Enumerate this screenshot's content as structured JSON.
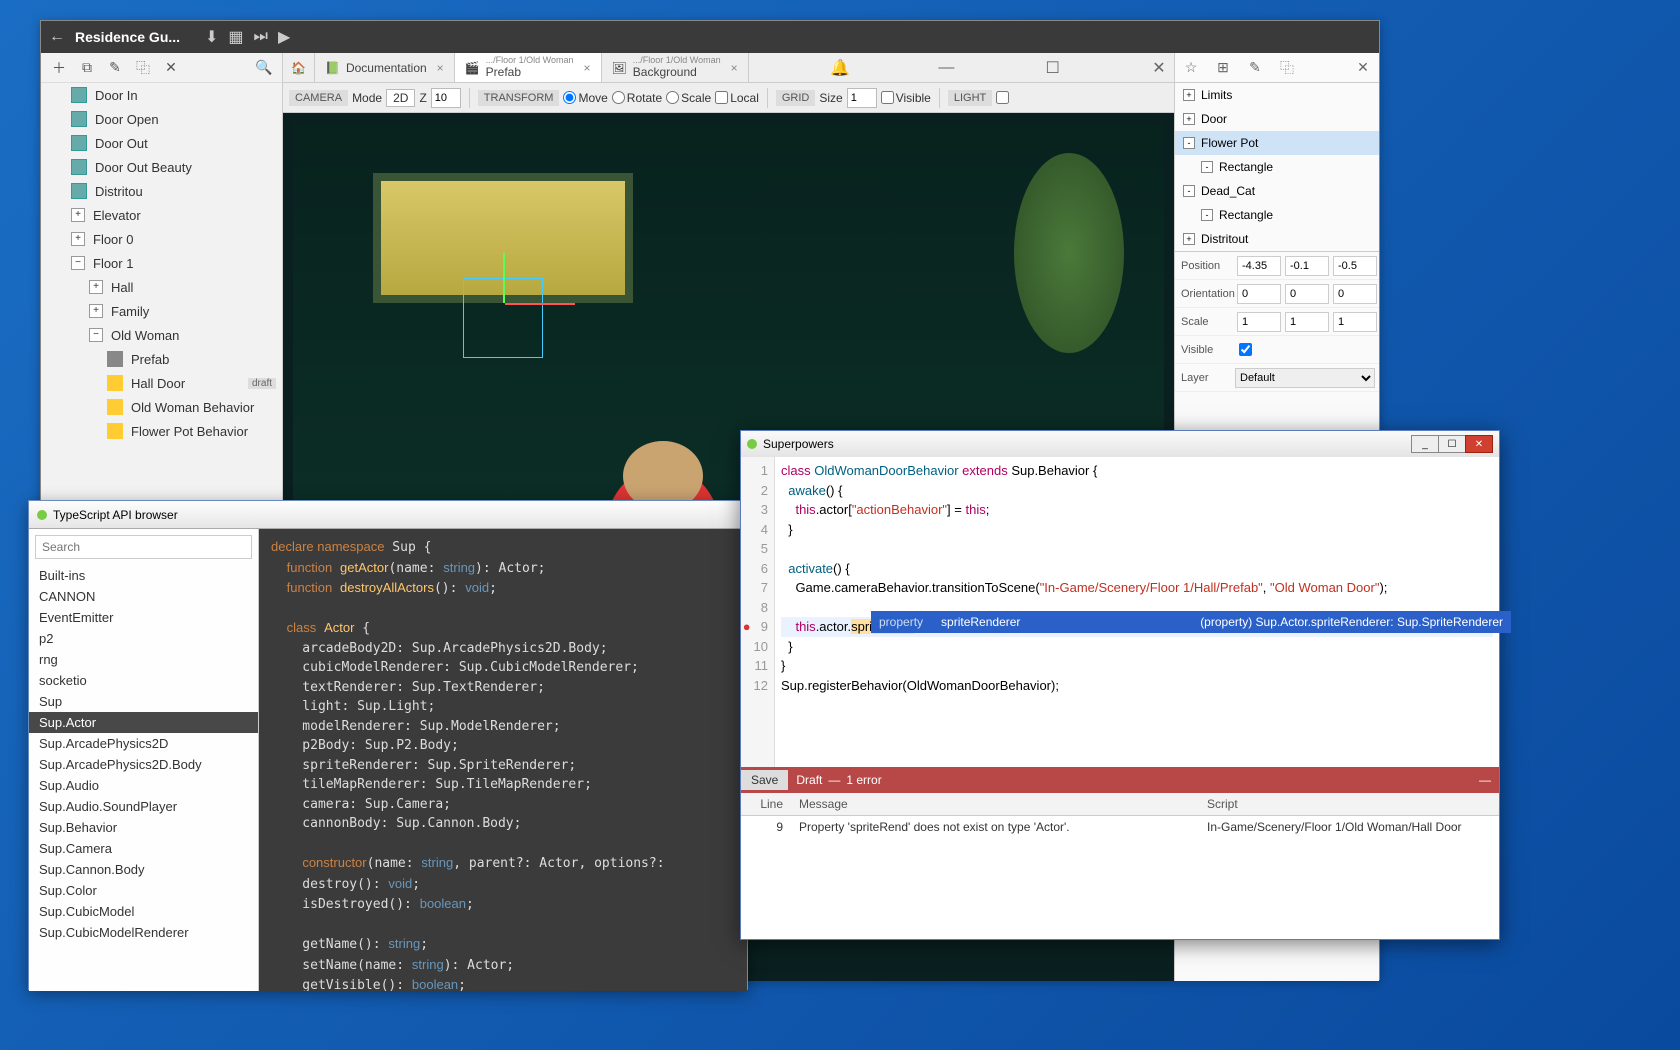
{
  "main": {
    "title": "Residence Gu...",
    "tabs": {
      "doc": "Documentation",
      "prefab_path": ".../Floor 1/Old Woman",
      "prefab_label": "Prefab",
      "bg_path": ".../Floor 1/Old Woman",
      "bg_label": "Background"
    },
    "toolbar": {
      "camera": "CAMERA",
      "mode": "Mode",
      "twoD": "2D",
      "z": "Z",
      "z_val": "10",
      "transform": "TRANSFORM",
      "move": "Move",
      "rotate": "Rotate",
      "scale": "Scale",
      "local": "Local",
      "grid": "GRID",
      "size": "Size",
      "size_val": "1",
      "visible": "Visible",
      "light": "LIGHT"
    },
    "tree": [
      {
        "indent": 1,
        "icon": "img",
        "label": "Door In"
      },
      {
        "indent": 1,
        "icon": "img",
        "label": "Door Open"
      },
      {
        "indent": 1,
        "icon": "img",
        "label": "Door Out"
      },
      {
        "indent": 1,
        "icon": "img",
        "label": "Door Out Beauty"
      },
      {
        "indent": 1,
        "icon": "img",
        "label": "Distritou"
      },
      {
        "indent": 1,
        "icon": "plus",
        "label": "Elevator"
      },
      {
        "indent": 1,
        "icon": "plus",
        "label": "Floor 0"
      },
      {
        "indent": 1,
        "icon": "minus",
        "label": "Floor 1"
      },
      {
        "indent": 2,
        "icon": "plus",
        "label": "Hall"
      },
      {
        "indent": 2,
        "icon": "plus",
        "label": "Family"
      },
      {
        "indent": 2,
        "icon": "minus",
        "label": "Old Woman"
      },
      {
        "indent": 3,
        "icon": "clap",
        "label": "Prefab"
      },
      {
        "indent": 3,
        "icon": "bolt",
        "label": "Hall Door",
        "badge": "draft"
      },
      {
        "indent": 3,
        "icon": "bolt",
        "label": "Old Woman Behavior"
      },
      {
        "indent": 3,
        "icon": "bolt",
        "label": "Flower Pot Behavior"
      }
    ],
    "hierarchy": [
      {
        "indent": 0,
        "exp": "+",
        "label": "Limits"
      },
      {
        "indent": 0,
        "exp": "+",
        "label": "Door"
      },
      {
        "indent": 0,
        "exp": "-",
        "label": "Flower Pot",
        "sel": true
      },
      {
        "indent": 1,
        "exp": "-",
        "label": "Rectangle"
      },
      {
        "indent": 0,
        "exp": "-",
        "label": "Dead_Cat"
      },
      {
        "indent": 1,
        "exp": "-",
        "label": "Rectangle"
      },
      {
        "indent": 0,
        "exp": "+",
        "label": "Distritout"
      }
    ],
    "props": {
      "position": {
        "label": "Position",
        "x": "-4.35",
        "y": "-0.1",
        "z": "-0.5"
      },
      "orientation": {
        "label": "Orientation",
        "x": "0",
        "y": "0",
        "z": "0"
      },
      "scale": {
        "label": "Scale",
        "x": "1",
        "y": "1",
        "z": "1"
      },
      "visible": {
        "label": "Visible",
        "val": true
      },
      "layer": {
        "label": "Layer",
        "val": "Default"
      }
    }
  },
  "api": {
    "title": "TypeScript API browser",
    "search_placeholder": "Search",
    "items": [
      "Built-ins",
      "CANNON",
      "EventEmitter",
      "p2",
      "rng",
      "socketio",
      "Sup",
      "Sup.Actor",
      "Sup.ArcadePhysics2D",
      "Sup.ArcadePhysics2D.Body",
      "Sup.Audio",
      "Sup.Audio.SoundPlayer",
      "Sup.Behavior",
      "Sup.Camera",
      "Sup.Cannon.Body",
      "Sup.Color",
      "Sup.CubicModel",
      "Sup.CubicModelRenderer"
    ],
    "selected": "Sup.Actor"
  },
  "sp": {
    "title": "Superpowers",
    "lines": [
      "1",
      "2",
      "3",
      "4",
      "5",
      "6",
      "7",
      "8",
      "9",
      "10",
      "11",
      "12"
    ],
    "typing": "spriteRend",
    "ac_kind": "property",
    "ac_name": "spriteRenderer",
    "ac_sig": "(property) Sup.Actor.spriteRenderer: Sup.SpriteRenderer",
    "save": "Save",
    "draft": "Draft",
    "errcount": "1 error",
    "th_line": "Line",
    "th_msg": "Message",
    "th_script": "Script",
    "err_line": "9",
    "err_msg": "Property 'spriteRend' does not exist on type 'Actor'.",
    "err_script": "In-Game/Scenery/Floor 1/Old Woman/Hall Door"
  }
}
